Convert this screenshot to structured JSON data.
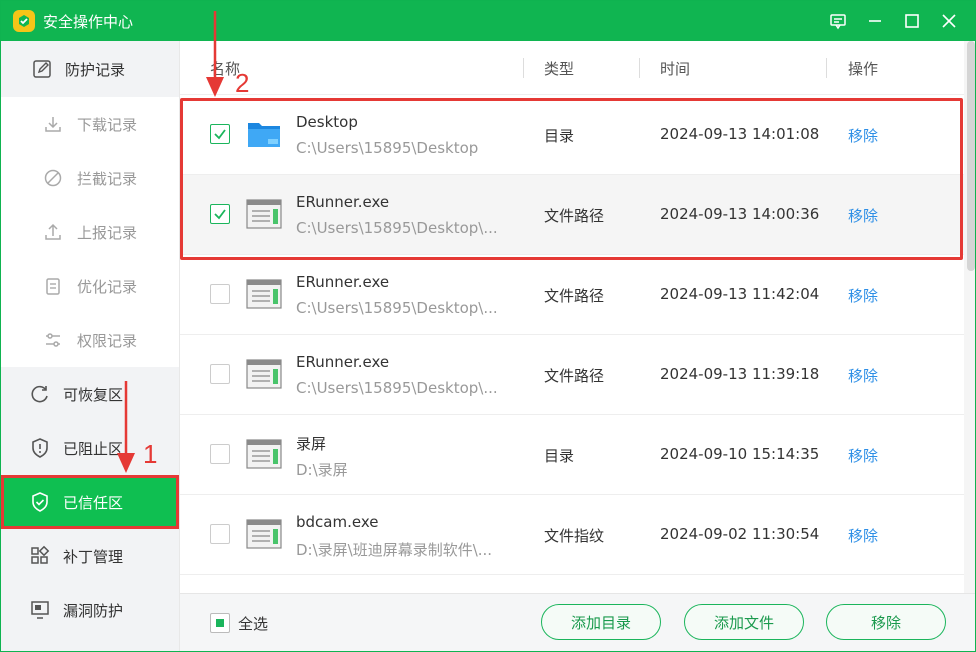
{
  "app": {
    "title": "安全操作中心"
  },
  "window_controls": [
    "feedback-icon",
    "minimize-icon",
    "maximize-icon",
    "close-icon"
  ],
  "sidebar": {
    "top": {
      "label": "防护记录",
      "icon": "edit-icon"
    },
    "sub_items": [
      {
        "label": "下载记录",
        "icon": "download-icon"
      },
      {
        "label": "拦截记录",
        "icon": "block-icon"
      },
      {
        "label": "上报记录",
        "icon": "upload-icon"
      },
      {
        "label": "优化记录",
        "icon": "clipboard-icon"
      },
      {
        "label": "权限记录",
        "icon": "sliders-icon"
      }
    ],
    "main_items": [
      {
        "label": "可恢复区",
        "icon": "restore-icon"
      },
      {
        "label": "已阻止区",
        "icon": "shield-alert-icon"
      },
      {
        "label": "已信任区",
        "icon": "shield-check-icon",
        "active": true
      },
      {
        "label": "补丁管理",
        "icon": "grid-icon"
      },
      {
        "label": "漏洞防护",
        "icon": "monitor-icon"
      }
    ]
  },
  "table": {
    "headers": {
      "name": "名称",
      "type": "类型",
      "time": "时间",
      "action": "操作"
    },
    "rows": [
      {
        "name": "Desktop",
        "path": "C:\\Users\\15895\\Desktop",
        "type": "目录",
        "time": "2024-09-13 14:01:08",
        "action": "移除",
        "checked": true,
        "icon": "folder-icon"
      },
      {
        "name": "ERunner.exe",
        "path": "C:\\Users\\15895\\Desktop\\...",
        "type": "文件路径",
        "time": "2024-09-13 14:00:36",
        "action": "移除",
        "checked": true,
        "icon": "file-window-icon"
      },
      {
        "name": "ERunner.exe",
        "path": "C:\\Users\\15895\\Desktop\\...",
        "type": "文件路径",
        "time": "2024-09-13 11:42:04",
        "action": "移除",
        "checked": false,
        "icon": "file-window-icon"
      },
      {
        "name": "ERunner.exe",
        "path": "C:\\Users\\15895\\Desktop\\...",
        "type": "文件路径",
        "time": "2024-09-13 11:39:18",
        "action": "移除",
        "checked": false,
        "icon": "file-window-icon"
      },
      {
        "name": "录屏",
        "path": "D:\\录屏",
        "type": "目录",
        "time": "2024-09-10 15:14:35",
        "action": "移除",
        "checked": false,
        "icon": "file-window-icon"
      },
      {
        "name": "bdcam.exe",
        "path": "D:\\录屏\\班迪屏幕录制软件\\...",
        "type": "文件指纹",
        "time": "2024-09-02 11:30:54",
        "action": "移除",
        "checked": false,
        "icon": "file-window-icon"
      }
    ]
  },
  "footer": {
    "select_all": "全选",
    "buttons": {
      "add_dir": "添加目录",
      "add_file": "添加文件",
      "remove": "移除"
    }
  },
  "annotations": {
    "step1": "1",
    "step2": "2"
  },
  "colors": {
    "brand": "#10b551",
    "link": "#2e8fe6",
    "annotation": "#e53935"
  }
}
